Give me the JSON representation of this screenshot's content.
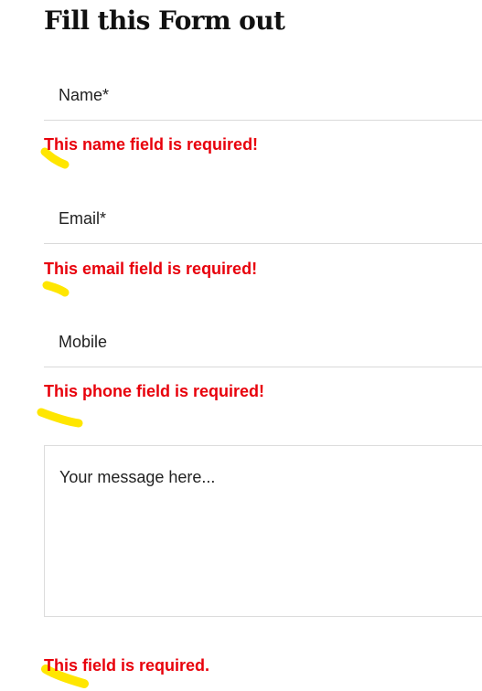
{
  "page": {
    "title": "Fill this Form out"
  },
  "form": {
    "name": {
      "placeholder": "Name*",
      "value": "",
      "error": "This name field is required!"
    },
    "email": {
      "placeholder": "Email*",
      "value": "",
      "error": "This email field is required!"
    },
    "mobile": {
      "placeholder": "Mobile",
      "value": "",
      "error": "This phone field is required!"
    },
    "message": {
      "placeholder": "Your message here...",
      "value": "",
      "error": "This field is required."
    }
  },
  "colors": {
    "error": "#e8000b",
    "highlighter": "#ffe600",
    "field_border": "#d9d9d9"
  }
}
